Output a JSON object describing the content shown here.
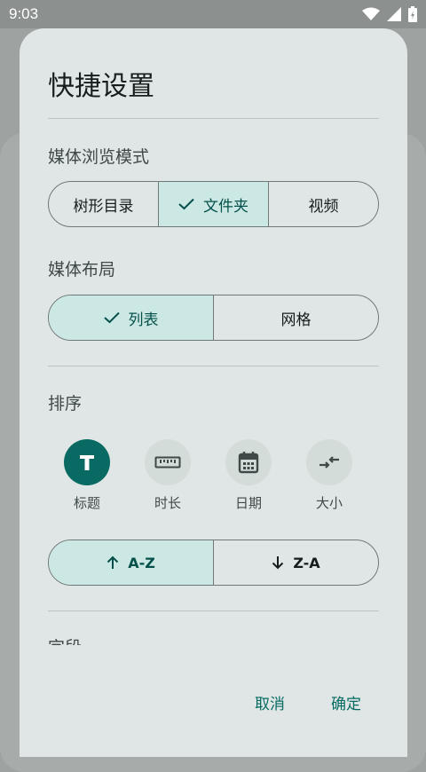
{
  "status": {
    "time": "9:03"
  },
  "dialog": {
    "title": "快捷设置",
    "browse_mode": {
      "label": "媒体浏览模式",
      "options": [
        "树形目录",
        "文件夹",
        "视频"
      ],
      "selected": 1
    },
    "layout": {
      "label": "媒体布局",
      "options": [
        "列表",
        "网格"
      ],
      "selected": 0
    },
    "sort": {
      "label": "排序",
      "fields": [
        {
          "label": "标题",
          "icon": "title-icon",
          "selected": true
        },
        {
          "label": "时长",
          "icon": "ruler-icon",
          "selected": false
        },
        {
          "label": "日期",
          "icon": "calendar-icon",
          "selected": false
        },
        {
          "label": "大小",
          "icon": "size-compare-icon",
          "selected": false
        }
      ],
      "direction": {
        "asc": "A-Z",
        "desc": "Z-A",
        "selected": "asc"
      }
    },
    "next_section_label": "字段",
    "actions": {
      "cancel": "取消",
      "confirm": "确定"
    }
  },
  "colors": {
    "accent": "#086a63",
    "selected_fill": "#cce8e4",
    "dialog_bg": "#e0e6e5"
  }
}
